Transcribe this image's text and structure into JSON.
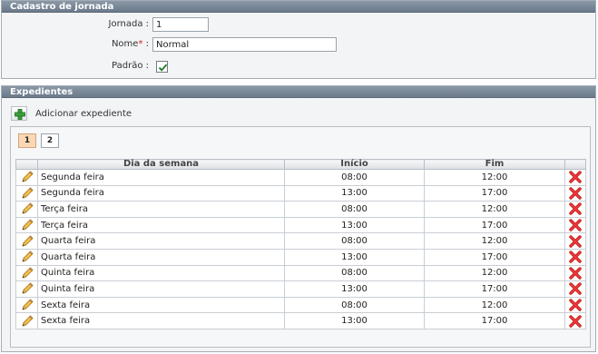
{
  "cadastro": {
    "header": "Cadastro de jornada",
    "jornada_label": "Jornada :",
    "jornada_value": "1",
    "nome_label": "Nome",
    "nome_required": "*",
    "nome_colon": " :",
    "nome_value": "Normal",
    "padrao_label": "Padrão :",
    "padrao_checked": true
  },
  "expedientes": {
    "header": "Expedientes",
    "add_label": "Adicionar expediente",
    "pages": [
      "1",
      "2"
    ],
    "active_page": "1",
    "columns": [
      "Dia da semana",
      "Início",
      "Fim"
    ],
    "rows": [
      {
        "day": "Segunda feira",
        "start": "08:00",
        "end": "12:00"
      },
      {
        "day": "Segunda feira",
        "start": "13:00",
        "end": "17:00"
      },
      {
        "day": "Terça feira",
        "start": "08:00",
        "end": "12:00"
      },
      {
        "day": "Terça feira",
        "start": "13:00",
        "end": "17:00"
      },
      {
        "day": "Quarta feira",
        "start": "08:00",
        "end": "12:00"
      },
      {
        "day": "Quarta feira",
        "start": "13:00",
        "end": "17:00"
      },
      {
        "day": "Quinta feira",
        "start": "08:00",
        "end": "12:00"
      },
      {
        "day": "Quinta feira",
        "start": "13:00",
        "end": "17:00"
      },
      {
        "day": "Sexta feira",
        "start": "08:00",
        "end": "12:00"
      },
      {
        "day": "Sexta feira",
        "start": "13:00",
        "end": "17:00"
      }
    ]
  },
  "icons": {
    "add": "plus-icon",
    "edit": "pencil-icon",
    "delete": "delete-x-icon",
    "check": "check-icon"
  }
}
